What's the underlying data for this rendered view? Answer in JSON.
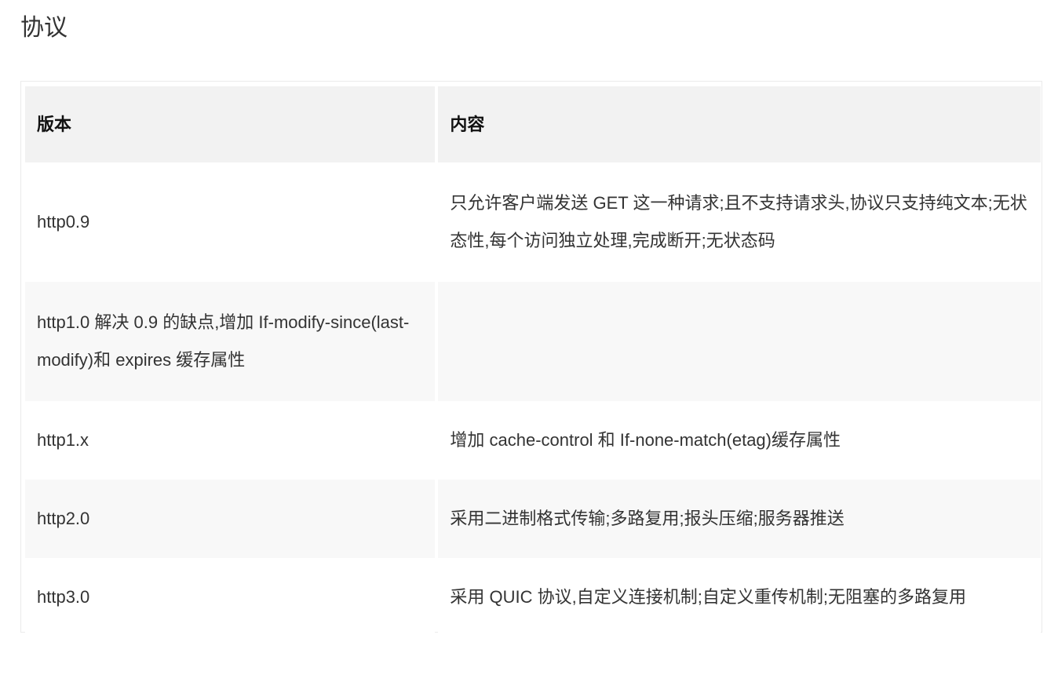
{
  "section": {
    "title": "协议"
  },
  "table": {
    "headers": [
      "版本",
      "内容"
    ],
    "rows": [
      [
        "http0.9",
        "只允许客户端发送 GET 这一种请求;且不支持请求头,协议只支持纯文本;无状态性,每个访问独立处理,完成断开;无状态码"
      ],
      [
        "http1.0 解决 0.9 的缺点,增加 If-modify-since(last-modify)和 expires 缓存属性",
        ""
      ],
      [
        "http1.x",
        "增加 cache-control 和 If-none-match(etag)缓存属性"
      ],
      [
        "http2.0",
        "采用二进制格式传输;多路复用;报头压缩;服务器推送"
      ],
      [
        "http3.0",
        "采用 QUIC 协议,自定义连接机制;自定义重传机制;无阻塞的多路复用"
      ]
    ]
  }
}
